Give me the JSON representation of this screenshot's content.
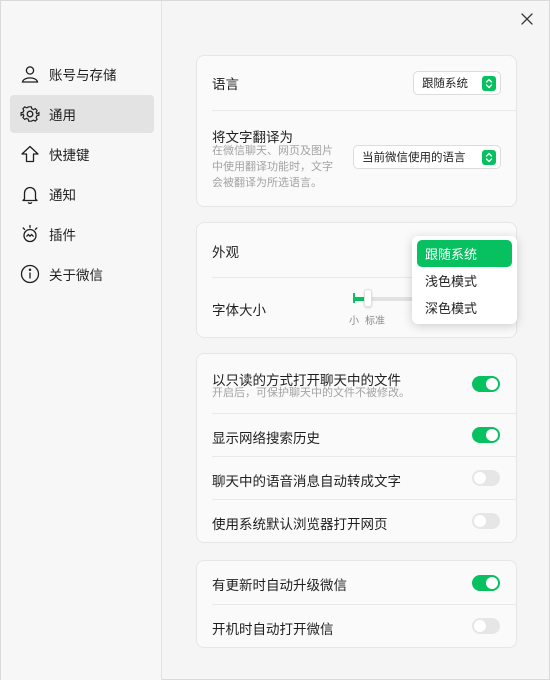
{
  "sidebar": {
    "items": [
      {
        "label": "账号与存储",
        "icon": "person-icon",
        "active": false
      },
      {
        "label": "通用",
        "icon": "gear-icon",
        "active": true
      },
      {
        "label": "快捷键",
        "icon": "arrow-up-icon",
        "active": false
      },
      {
        "label": "通知",
        "icon": "bell-icon",
        "active": false
      },
      {
        "label": "插件",
        "icon": "plugin-icon",
        "active": false
      },
      {
        "label": "关于微信",
        "icon": "info-icon",
        "active": false
      }
    ]
  },
  "language_card": {
    "language_label": "语言",
    "language_value": "跟随系统",
    "translate_label": "将文字翻译为",
    "translate_desc_lines": [
      "在微信聊天、网页及图片",
      "中使用翻译功能时，文字",
      "会被翻译为所选语言。"
    ],
    "translate_value": "当前微信使用的语言"
  },
  "appearance_card": {
    "appearance_label": "外观",
    "font_size_label": "字体大小",
    "font_size_small": "小",
    "font_size_standard": "标准",
    "font_size_level": 0.25
  },
  "appearance_dropdown": {
    "options": [
      "跟随系统",
      "浅色模式",
      "深色模式"
    ],
    "selected_index": 0
  },
  "files_card": {
    "readonly_label": "以只读的方式打开聊天中的文件",
    "readonly_desc": "开启后，可保护聊天中的文件不被修改。",
    "readonly_on": true,
    "search_history_label": "显示网络搜索历史",
    "search_history_on": true,
    "voice_to_text_label": "聊天中的语音消息自动转成文字",
    "voice_to_text_on": false,
    "system_browser_label": "使用系统默认浏览器打开网页",
    "system_browser_on": false
  },
  "update_card": {
    "auto_update_label": "有更新时自动升级微信",
    "auto_update_on": true,
    "auto_start_label": "开机时自动打开微信",
    "auto_start_on": false
  },
  "colors": {
    "accent": "#07c160",
    "background": "#f5f5f5",
    "card": "#fafafa"
  }
}
